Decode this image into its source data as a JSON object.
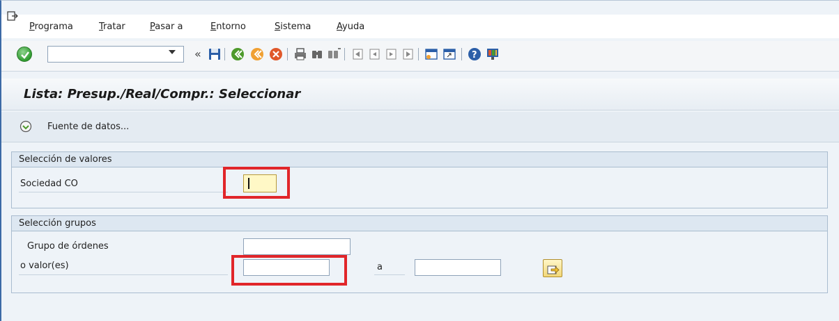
{
  "menu": {
    "items": [
      {
        "label": "Programa",
        "accel": "P"
      },
      {
        "label": "Tratar",
        "accel": "T"
      },
      {
        "label": "Pasar a",
        "accel": "P"
      },
      {
        "label": "Entorno",
        "accel": "E"
      },
      {
        "label": "Sistema",
        "accel": "S"
      },
      {
        "label": "Ayuda",
        "accel": "A"
      }
    ]
  },
  "toolbar": {
    "command_value": "",
    "icons": [
      "enter-icon",
      "command-field",
      "back-icon",
      "save-icon",
      "back-nav-icon",
      "exit-icon",
      "cancel-icon",
      "print-icon",
      "find-icon",
      "find-next-icon",
      "first-page-icon",
      "prev-page-icon",
      "next-page-icon",
      "last-page-icon",
      "new-session-icon",
      "shortcut-icon",
      "help-icon",
      "layout-icon"
    ]
  },
  "title": "Lista: Presup./Real/Compr.: Seleccionar",
  "app_toolbar": {
    "datasource_label": "Fuente de datos..."
  },
  "group_values": {
    "header": "Selección de valores",
    "sociedad_label": "Sociedad CO",
    "sociedad_value": ""
  },
  "group_groups": {
    "header": "Selección grupos",
    "grupo_label": "Grupo de órdenes",
    "grupo_value": "",
    "valor_label": "o valor(es)",
    "valor_from": "",
    "to_label": "a",
    "valor_to": ""
  },
  "colors": {
    "highlight": "#e1262a",
    "required_field": "#fff8c6"
  }
}
